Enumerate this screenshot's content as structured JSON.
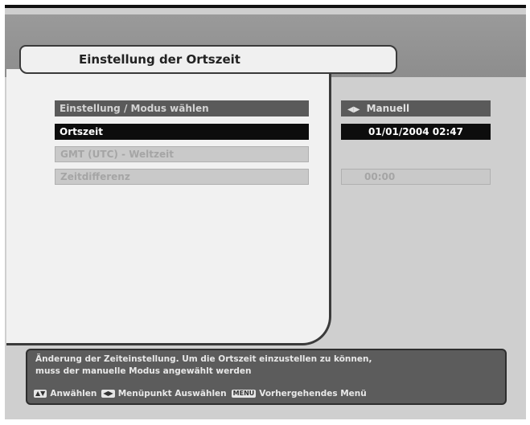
{
  "header": {
    "title": "Einstellung der Ortszeit"
  },
  "menu": {
    "items": [
      {
        "label": "Einstellung / Modus wählen",
        "value": "Manuell",
        "state": "normal"
      },
      {
        "label": "Ortszeit",
        "value": "01/01/2004 02:47",
        "state": "selected"
      },
      {
        "label": "GMT (UTC) - Weltzeit",
        "value": "",
        "state": "disabled"
      },
      {
        "label": "Zeitdifferenz",
        "value": "00:00",
        "state": "disabled"
      }
    ]
  },
  "help": {
    "line1": "Änderung der Zeiteinstellung. Um die Ortszeit einzustellen zu können,",
    "line2": "muss der manuelle Modus angewählt werden",
    "legend": {
      "select_icon": "▲▼",
      "select_label": "Anwählen",
      "menu_icon": "◀▶",
      "menu_label": "Menüpunkt Auswählen",
      "back_icon": "MENU",
      "back_label": "Vorhergehendes Menü"
    }
  },
  "icons": {
    "left_right": "◀▶"
  },
  "colors": {
    "row_dark": "#5a5a5a",
    "row_selected": "#0d0d0d",
    "row_disabled": "#c9c9c9",
    "panel": "#f1f1f1"
  }
}
